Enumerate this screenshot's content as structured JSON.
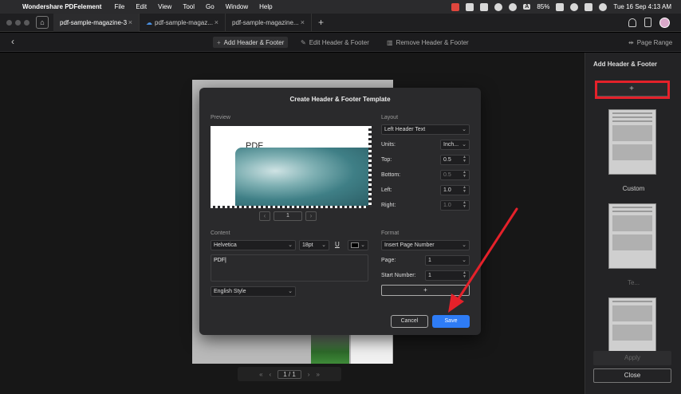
{
  "menubar": {
    "app_name": "Wondershare PDFelement",
    "items": [
      "File",
      "Edit",
      "View",
      "Tool",
      "Go",
      "Window",
      "Help"
    ],
    "battery": "85%",
    "input_badge": "A",
    "datetime": "Tue 16 Sep  4:13 AM"
  },
  "tabs": [
    {
      "label": "pdf-sample-magazine-3",
      "close": "×"
    },
    {
      "label": "pdf-sample-magaz...",
      "close": "×"
    },
    {
      "label": "pdf-sample-magazine...",
      "close": "×"
    }
  ],
  "tab_add": "+",
  "toolbar": {
    "add_header_footer": "Add Header & Footer",
    "edit_header_footer": "Edit Header & Footer",
    "remove_header_footer": "Remove Header & Footer",
    "page_range": "Page Range"
  },
  "page_nav": {
    "current": "1",
    "separator": "/",
    "total": "1"
  },
  "right_panel": {
    "title": "Add Header & Footer",
    "add_symbol": "+",
    "template1_label": "Custom",
    "template2_label": "Te...",
    "apply": "Apply",
    "close": "Close"
  },
  "dialog": {
    "title": "Create Header & Footer Template",
    "preview_label": "Preview",
    "preview_text": "PDF",
    "preview_page": "1",
    "layout_label": "Layout",
    "layout_value": "Left Header Text",
    "units_label": "Units:",
    "units_value": "Inch...",
    "top_label": "Top:",
    "top_value": "0.5",
    "bottom_label": "Bottom:",
    "bottom_value": "0.5",
    "left_label": "Left:",
    "left_value": "1.0",
    "right_label": "Right:",
    "right_value": "1.0",
    "content_label": "Content",
    "font_value": "Helvetica",
    "size_value": "18pt",
    "underline": "U",
    "content_text": "PDF",
    "style_value": "English Style",
    "format_label": "Format",
    "format_value": "Insert Page Number",
    "page_label": "Page:",
    "page_value": "1",
    "start_label": "Start Number:",
    "start_value": "1",
    "plus": "+",
    "cancel": "Cancel",
    "save": "Save"
  },
  "colors": {
    "accent": "#2e7cf6",
    "highlight": "#e5212a",
    "arrow": "#e5212a"
  }
}
